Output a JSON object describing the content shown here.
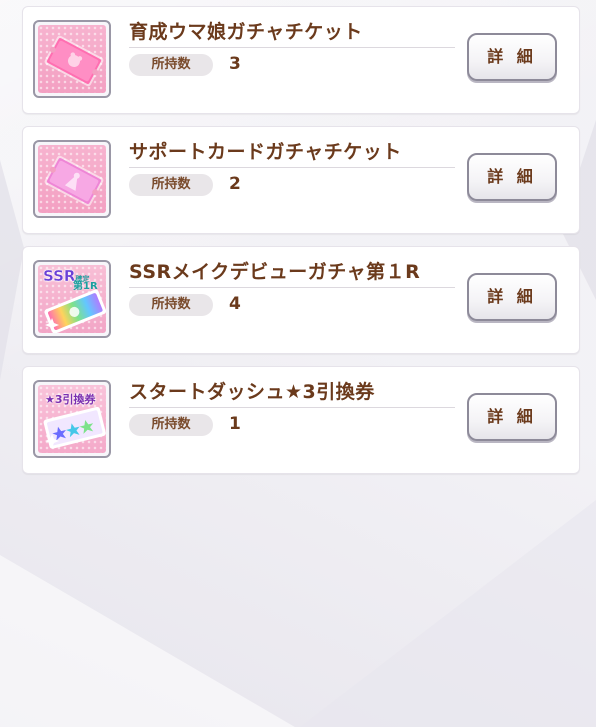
{
  "items": [
    {
      "name": "育成ウマ娘ガチャチケット",
      "qty_label": "所持数",
      "qty": "3",
      "detail_label": "詳 細",
      "icon": "pink-gacha-ticket-icon"
    },
    {
      "name": "サポートカードガチャチケット",
      "qty_label": "所持数",
      "qty": "2",
      "detail_label": "詳 細",
      "icon": "support-card-ticket-icon"
    },
    {
      "name": "SSRメイクデビューガチャ第１R",
      "qty_label": "所持数",
      "qty": "4",
      "detail_label": "詳 細",
      "icon": "ssr-ticket-icon",
      "icon_text": {
        "ssr": "SSR",
        "confirmed": "確定",
        "round": "第1R"
      }
    },
    {
      "name": "スタートダッシュ★3引換券",
      "qty_label": "所持数",
      "qty": "1",
      "detail_label": "詳 細",
      "icon": "star3-exchange-ticket-icon",
      "icon_text": {
        "label": "★3引換券"
      }
    }
  ],
  "colors": {
    "text_brown": "#6b3a1c",
    "pill_bg": "#e9e6e9",
    "card_bg": "#ffffff",
    "page_bg": "#f2f1f5"
  }
}
